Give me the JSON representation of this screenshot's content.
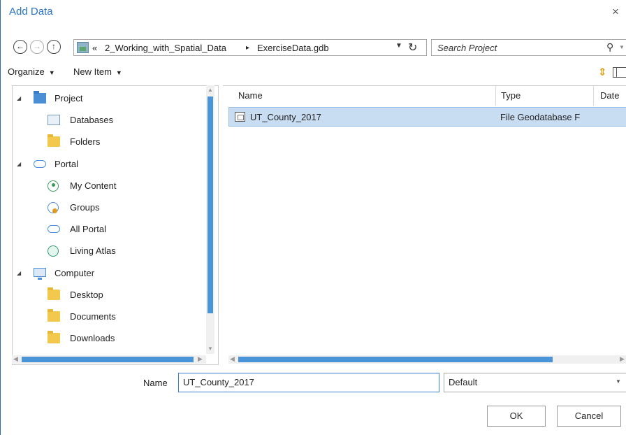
{
  "window": {
    "title": "Add Data",
    "close_glyph": "×"
  },
  "nav": {
    "back_glyph": "←",
    "forward_glyph": "→",
    "up_glyph": "↑",
    "crumb_overflow": "«",
    "crumbs": [
      "2_Working_with_Spatial_Data",
      "ExerciseData.gdb"
    ],
    "crumb_separator": "▸",
    "refresh_glyph": "↻"
  },
  "search": {
    "placeholder": "Search Project",
    "icon_glyph": "⚲"
  },
  "toolbar": {
    "organize_label": "Organize",
    "new_item_label": "New Item",
    "caret": "▼"
  },
  "tree": {
    "project": {
      "label": "Project",
      "children": [
        "Databases",
        "Folders"
      ]
    },
    "portal": {
      "label": "Portal",
      "children": [
        "My Content",
        "Groups",
        "All Portal",
        "Living Atlas"
      ]
    },
    "computer": {
      "label": "Computer",
      "children": [
        "Desktop",
        "Documents",
        "Downloads"
      ]
    }
  },
  "files": {
    "columns": [
      "Name",
      "Type",
      "Date"
    ],
    "rows": [
      {
        "name": "UT_County_2017",
        "type": "File Geodatabase F",
        "selected": true
      }
    ]
  },
  "footer": {
    "name_label": "Name",
    "name_value": "UT_County_2017",
    "filter_value": "Default",
    "ok_label": "OK",
    "cancel_label": "Cancel"
  },
  "colors": {
    "accent": "#2b73c2",
    "selection": "#c8ddf2",
    "scroll_thumb": "#4a95d9",
    "folder": "#f2c94c"
  }
}
